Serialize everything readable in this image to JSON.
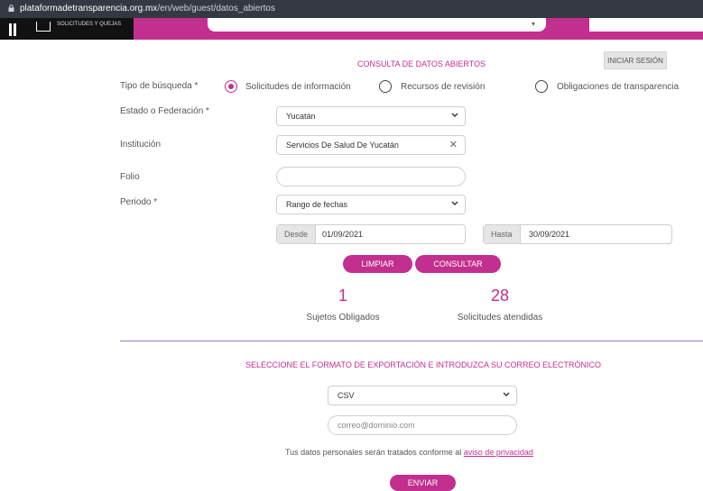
{
  "browser": {
    "url_host": "plataformadetransparencia.org.mx",
    "url_path": "/en/web/guest/datos_abiertos"
  },
  "topnav": {
    "label": "SOLICITUDES Y QUEJAS"
  },
  "header": {
    "login_label": "INICIAR SESIÓN",
    "title": "CONSULTA DE DATOS ABIERTOS"
  },
  "form": {
    "search_type_label": "Tipo de búsqueda *",
    "search_types": [
      {
        "label": "Solicitudes de información",
        "selected": true
      },
      {
        "label": "Recursos de revisión",
        "selected": false
      },
      {
        "label": "Obligaciones de transparencia",
        "selected": false
      }
    ],
    "state_label": "Estado o Federación *",
    "state_value": "Yucatán",
    "institution_label": "Institución",
    "institution_value": "Servicios De Salud De Yucatán",
    "folio_label": "Folio",
    "folio_value": "",
    "period_label": "Periodo *",
    "period_value": "Rango de fechas",
    "from_label": "Desde",
    "from_value": "01/09/2021",
    "to_label": "Hasta",
    "to_value": "30/09/2021",
    "clear_label": "LIMPIAR",
    "query_label": "CONSULTAR"
  },
  "results": {
    "subjects_count": "1",
    "subjects_label": "Sujetos Obligados",
    "requests_count": "28",
    "requests_label": "Solicitudes atendidas"
  },
  "export": {
    "title": "SELECCIONE EL FORMATO DE EXPORTACIÓN E INTRODUZCA SU CORREO ELECTRÓNICO",
    "format_value": "CSV",
    "email_placeholder": "correo@dominio.com",
    "privacy_text": "Tus datos personales serán tratados conforme al",
    "privacy_link": "aviso de privacidad",
    "send_label": "ENVIAR"
  },
  "colors": {
    "accent": "#c32f8e",
    "divider": "#9a7db8"
  }
}
